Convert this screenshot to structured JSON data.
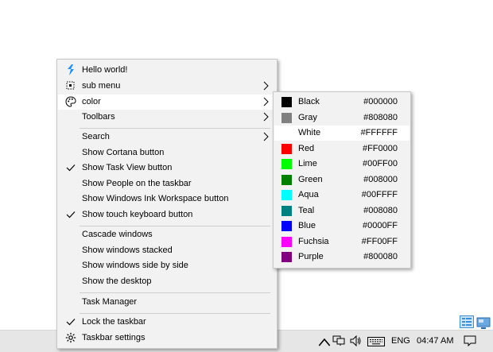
{
  "context_menu": {
    "items": [
      {
        "label": "Hello world!",
        "icon": "app-logo-icon",
        "checked": false,
        "submenu": false
      },
      {
        "label": "sub menu",
        "icon": "grid-cursor-icon",
        "checked": false,
        "submenu": true
      },
      {
        "label": "color",
        "icon": "palette-icon",
        "checked": false,
        "submenu": true,
        "highlighted": true
      },
      {
        "label": "Toolbars",
        "icon": "",
        "checked": false,
        "submenu": true
      },
      {
        "label": "Search",
        "icon": "",
        "checked": false,
        "submenu": true
      },
      {
        "label": "Show Cortana button",
        "icon": "",
        "checked": false,
        "submenu": false
      },
      {
        "label": "Show Task View button",
        "icon": "check-icon",
        "checked": true,
        "submenu": false
      },
      {
        "label": "Show People on the taskbar",
        "icon": "",
        "checked": false,
        "submenu": false
      },
      {
        "label": "Show Windows Ink Workspace button",
        "icon": "",
        "checked": false,
        "submenu": false
      },
      {
        "label": "Show touch keyboard button",
        "icon": "check-icon",
        "checked": true,
        "submenu": false
      },
      {
        "label": "Cascade windows",
        "icon": "",
        "checked": false,
        "submenu": false
      },
      {
        "label": "Show windows stacked",
        "icon": "",
        "checked": false,
        "submenu": false
      },
      {
        "label": "Show windows side by side",
        "icon": "",
        "checked": false,
        "submenu": false
      },
      {
        "label": "Show the desktop",
        "icon": "",
        "checked": false,
        "submenu": false
      },
      {
        "label": "Task Manager",
        "icon": "",
        "checked": false,
        "submenu": false
      },
      {
        "label": "Lock the taskbar",
        "icon": "check-icon",
        "checked": true,
        "submenu": false
      },
      {
        "label": "Taskbar settings",
        "icon": "gear-icon",
        "checked": false,
        "submenu": false
      }
    ]
  },
  "color_submenu": {
    "items": [
      {
        "name": "Black",
        "hex": "#000000"
      },
      {
        "name": "Gray",
        "hex": "#808080"
      },
      {
        "name": "White",
        "hex": "#FFFFFF"
      },
      {
        "name": "Red",
        "hex": "#FF0000"
      },
      {
        "name": "Lime",
        "hex": "#00FF00"
      },
      {
        "name": "Green",
        "hex": "#008000"
      },
      {
        "name": "Aqua",
        "hex": "#00FFFF"
      },
      {
        "name": "Teal",
        "hex": "#008080"
      },
      {
        "name": "Blue",
        "hex": "#0000FF"
      },
      {
        "name": "Fuchsia",
        "hex": "#FF00FF"
      },
      {
        "name": "Purple",
        "hex": "#800080"
      }
    ]
  },
  "taskbar": {
    "language": "ENG",
    "time": "04:47 AM",
    "tray_icons": [
      "chevron-up-icon",
      "network-icon",
      "volume-icon",
      "keyboard-icon",
      "notification-icon"
    ]
  },
  "desktop_icons": [
    "list-view-icon",
    "screen-icon"
  ],
  "colors": {
    "menu_bg": "#f2f2f2",
    "highlight": "#ffffff",
    "taskbar_bg": "#e6e6e6",
    "logo_blue": "#1e90ff"
  }
}
